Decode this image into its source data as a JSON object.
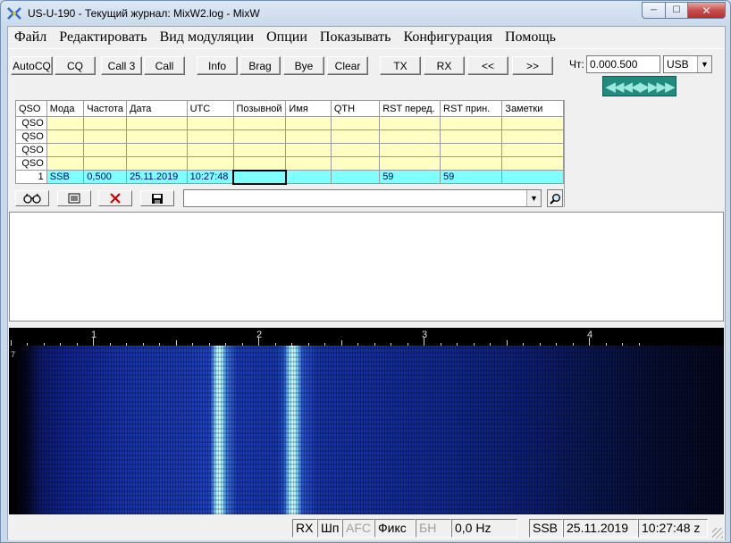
{
  "window": {
    "title": "US-U-190 - Текущий журнал: MixW2.log - MixW"
  },
  "menu": [
    "Файл",
    "Редактировать",
    "Вид модуляции",
    "Опции",
    "Показывать",
    "Конфигурация",
    "Помощь"
  ],
  "toolbar": {
    "buttons": [
      "AutoCQ",
      "CQ",
      "Call 3",
      "Call",
      "Info",
      "Brag",
      "Bye",
      "Clear",
      "TX",
      "RX",
      "<<",
      ">>"
    ]
  },
  "freq": {
    "label": "Чт:",
    "value": "0.000.500",
    "mode": "USB"
  },
  "log": {
    "headers": [
      "QSO",
      "Мода",
      "Частота",
      "Дата",
      "UTC",
      "Позывной",
      "Имя",
      "QTH",
      "RST перед.",
      "RST прин.",
      "Заметки"
    ],
    "blank_label": "QSO",
    "blank_rows": 4,
    "current": {
      "num": "1",
      "mode": "SSB",
      "freq": "0,500",
      "date": "25.11.2019",
      "utc": "10:27:48",
      "call": "",
      "name": "",
      "qth": "",
      "rst_sent": "59",
      "rst_rcvd": "59",
      "notes": ""
    }
  },
  "scale": {
    "labels": [
      "1",
      "2",
      "3",
      "4"
    ]
  },
  "waterfall": {
    "marker": "7"
  },
  "status": {
    "rx": "RX",
    "squelch": "Шп",
    "afc": "AFC",
    "fix": "Фикс",
    "bn": "БН",
    "offset": "0,0 Hz",
    "mode": "SSB",
    "date": "25.11.2019",
    "time": "10:27:48 z"
  }
}
